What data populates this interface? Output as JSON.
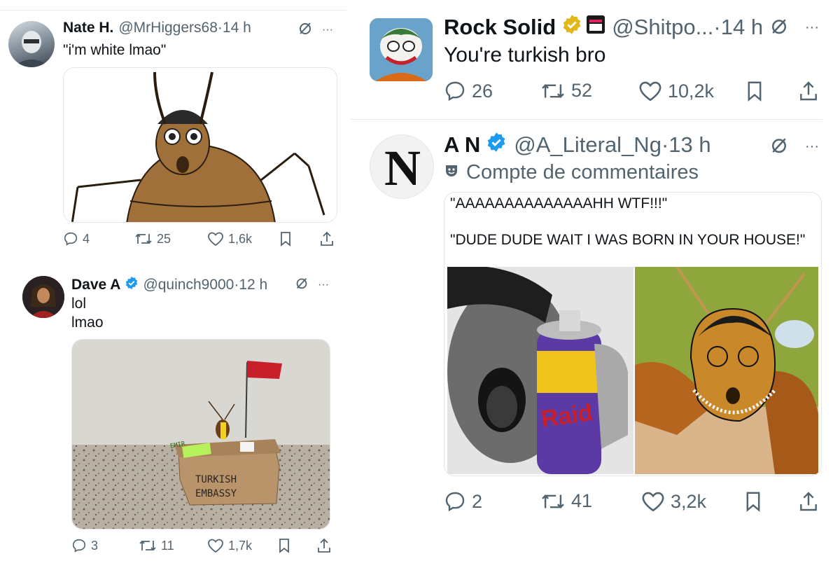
{
  "tweets": [
    {
      "name": "Nate H.",
      "handle": "@MrHiggers68",
      "time": "14 h",
      "lines": [
        "\"i'm white lmao\""
      ],
      "replies": "4",
      "reposts": "25",
      "likes": "1,6k",
      "media": "cockroach cartoon drawing"
    },
    {
      "name": "Dave A",
      "handle": "@quinch9000",
      "time": "12 h",
      "verified": true,
      "lines": [
        "lol",
        "lmao"
      ],
      "replies": "3",
      "reposts": "11",
      "likes": "1,7k",
      "media": "cockroach on cardboard box with flag",
      "sticky_note": "EMIR",
      "box_text": [
        "TURKISH",
        "EMBASSY"
      ]
    },
    {
      "name": "Rock Solid",
      "handle": "@Shitpo...",
      "time": "14 h",
      "verified": true,
      "lines": [
        "You're turkish bro"
      ],
      "replies": "26",
      "reposts": "52",
      "likes": "10,2k"
    },
    {
      "name": "A N",
      "handle": "@A_Literal_Ng",
      "time": "13 h",
      "verified": true,
      "community_note": "Compte de commentaires",
      "quote_lines": [
        "\"AAAAAAAAAAAAAAHH WTF!!!\"",
        "\"DUDE DUDE WAIT I WAS BORN IN YOUR HOUSE!\""
      ],
      "can_label": "Raid",
      "replies": "2",
      "reposts": "41",
      "likes": "3,2k"
    }
  ],
  "separator": "·",
  "more": "···",
  "avatar_letter": "N",
  "colors": {
    "text": "#0f1419",
    "muted": "#536471",
    "verified_blue": "#1d9bf0",
    "verified_gold": "#e2b719",
    "border": "#e2e6e9",
    "roach": "#a0703a"
  },
  "icons": [
    "reply-icon",
    "repost-icon",
    "like-icon",
    "bookmark-icon",
    "share-icon",
    "grok-icon",
    "more-icon",
    "verified-icon"
  ]
}
